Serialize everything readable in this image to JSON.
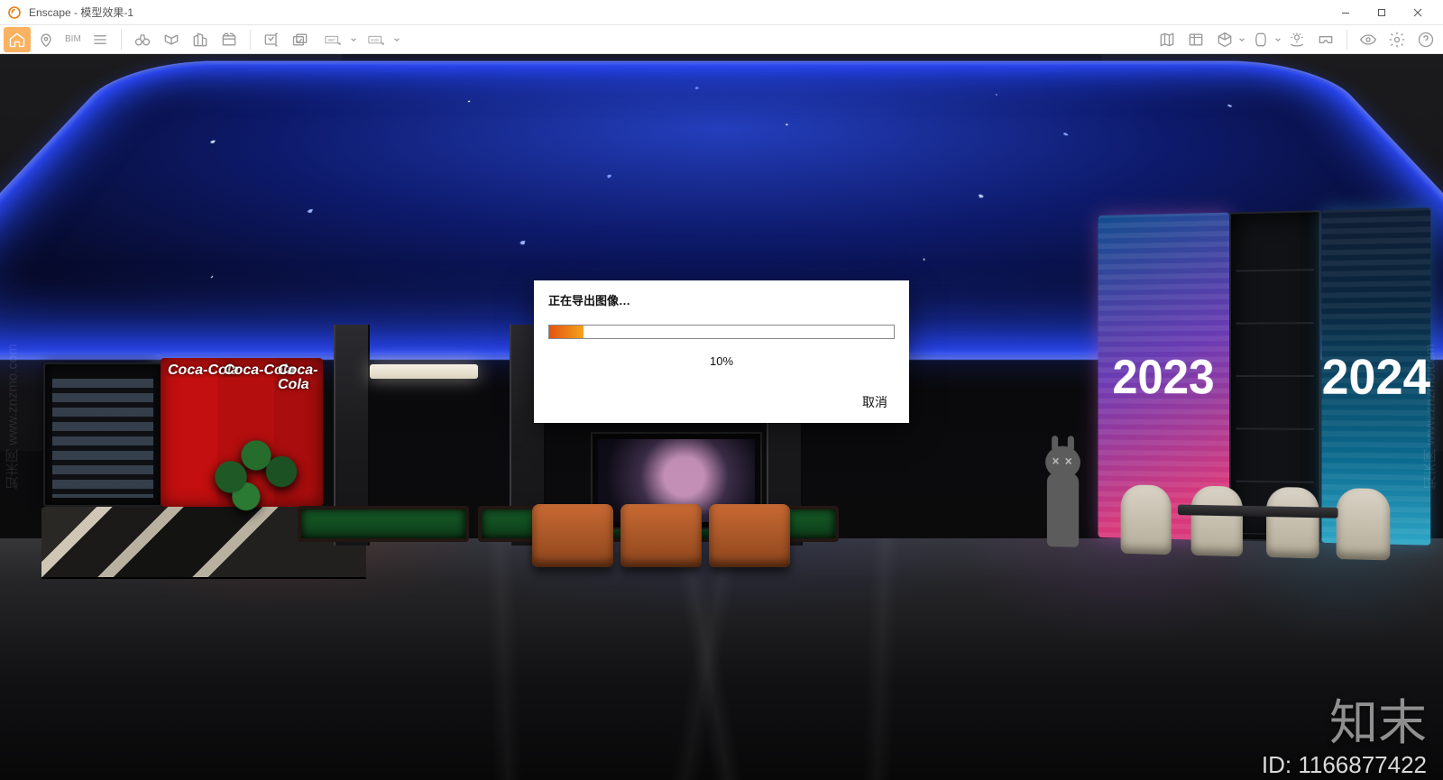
{
  "app": {
    "name": "Enscape",
    "title_suffix": "模型效果-1",
    "full_title": "Enscape - 模型效果-1"
  },
  "window_controls": {
    "minimize": "minimize",
    "maximize": "maximize",
    "close": "close"
  },
  "toolbar_left": {
    "home": "home",
    "pin": "map-pin",
    "bim_label": "BIM",
    "menu": "menu",
    "binoculars": "binoculars",
    "section": "section-plane",
    "buildings": "buildings",
    "clapper": "video-path"
  },
  "toolbar_export": {
    "screenshot": "screenshot",
    "batch": "batch-render",
    "pano_label": "360°",
    "pano": "panorama",
    "exe_label": "EXE",
    "exe": "standalone-export"
  },
  "toolbar_right": {
    "map": "site-context",
    "assets": "asset-library",
    "cube": "materials",
    "fov": "field-of-view",
    "sun": "sun-orbit",
    "vr": "vr-headset",
    "eye": "visual-settings",
    "gear": "settings",
    "help": "help"
  },
  "collapse": {
    "aria": "collapse-toolbar"
  },
  "scene": {
    "coke_brand": "Coca-Cola",
    "panel_left": "2023",
    "panel_right": "2024"
  },
  "dialog": {
    "title": "正在导出图像…",
    "percent_value": 10,
    "percent_text": "10%",
    "cancel": "取消"
  },
  "watermark": {
    "column_text": "知末网 www.znzmo.com",
    "brand": "知末",
    "id_label": "ID: 1166877422"
  }
}
